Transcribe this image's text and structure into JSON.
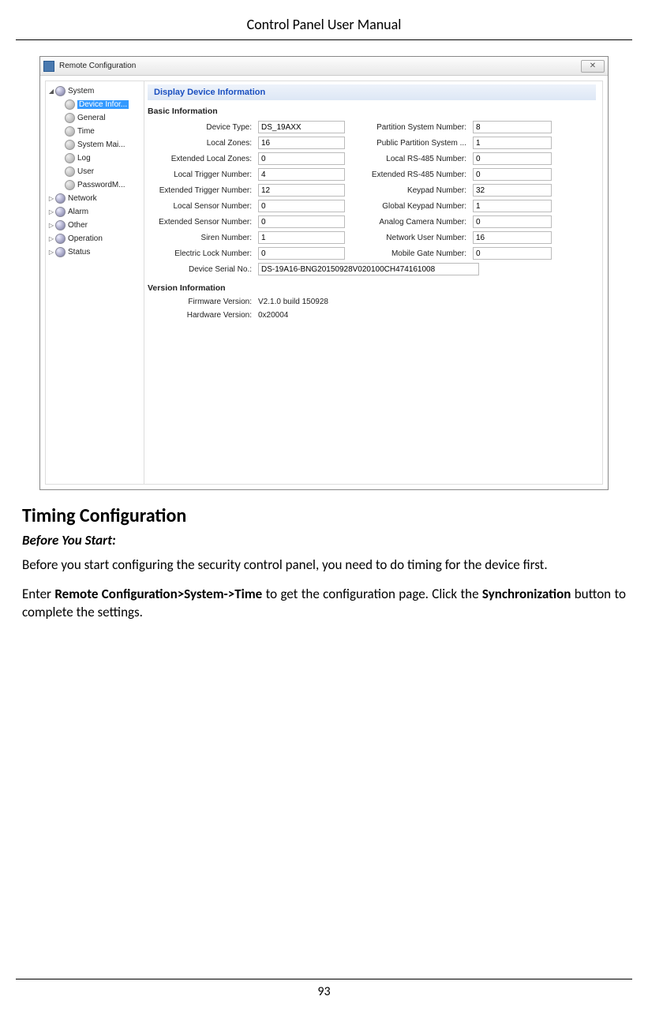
{
  "page": {
    "header": "Control Panel User Manual",
    "number": "93"
  },
  "window": {
    "title": "Remote Configuration",
    "close": "✕"
  },
  "tree": {
    "system": "System",
    "children": {
      "device_info": "Device Infor...",
      "general": "General",
      "time": "Time",
      "system_mai": "System Mai...",
      "log": "Log",
      "user": "User",
      "passwordm": "PasswordM..."
    },
    "network": "Network",
    "alarm": "Alarm",
    "other": "Other",
    "operation": "Operation",
    "status": "Status"
  },
  "panel": {
    "banner": "Display Device Information",
    "basic_heading": "Basic Information",
    "labels": {
      "device_type": "Device Type:",
      "local_zones": "Local Zones:",
      "ext_local_zones": "Extended Local Zones:",
      "local_trigger": "Local Trigger Number:",
      "ext_trigger": "Extended Trigger Number:",
      "local_sensor": "Local Sensor Number:",
      "ext_sensor": "Extended Sensor Number:",
      "siren": "Siren Number:",
      "elock": "Electric Lock Number:",
      "serial": "Device Serial No.:",
      "partition": "Partition System Number:",
      "pub_partition": "Public Partition System ...",
      "local_rs485": "Local RS-485 Number:",
      "ext_rs485": "Extended RS-485 Number:",
      "keypad": "Keypad Number:",
      "global_keypad": "Global Keypad Number:",
      "analog_cam": "Analog Camera Number:",
      "net_user": "Network User Number:",
      "mobile_gate": "Mobile Gate Number:"
    },
    "values": {
      "device_type": "DS_19AXX",
      "local_zones": "16",
      "ext_local_zones": "0",
      "local_trigger": "4",
      "ext_trigger": "12",
      "local_sensor": "0",
      "ext_sensor": "0",
      "siren": "1",
      "elock": "0",
      "serial": "DS-19A16-BNG20150928V020100CH474161008",
      "partition": "8",
      "pub_partition": "1",
      "local_rs485": "0",
      "ext_rs485": "0",
      "keypad": "32",
      "global_keypad": "1",
      "analog_cam": "0",
      "net_user": "16",
      "mobile_gate": "0"
    },
    "version_heading": "Version Information",
    "version_labels": {
      "firmware": "Firmware Version:",
      "hardware": "Hardware Version:"
    },
    "version_values": {
      "firmware": "V2.1.0 build 150928",
      "hardware": "0x20004"
    }
  },
  "body": {
    "h2": "Timing Configuration",
    "h3": "Before You Start:",
    "p1": "Before you start configuring the security control panel, you need to do timing for the device first.",
    "p2a": "Enter ",
    "p2b": "Remote Configuration>System->Time",
    "p2c": " to get the configuration page. Click the ",
    "p2d": "Synchronization",
    "p2e": " button to complete the settings."
  }
}
